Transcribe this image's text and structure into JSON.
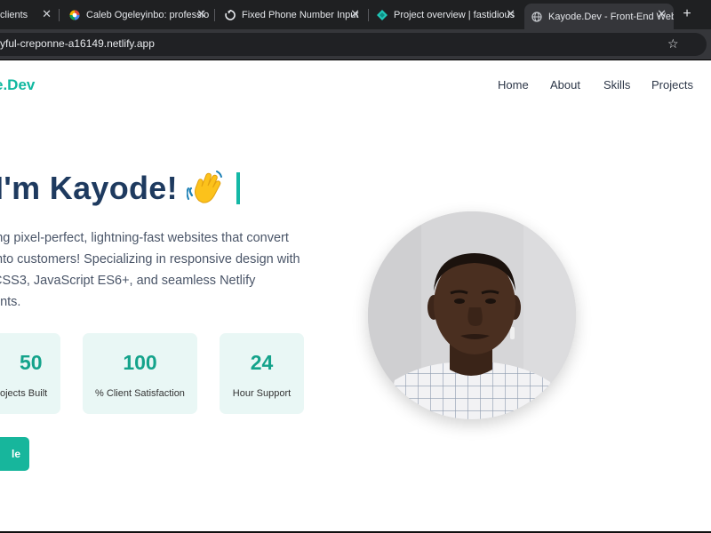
{
  "browser": {
    "tabs": [
      {
        "title": "clients",
        "favicon": "none",
        "active": false
      },
      {
        "title": "Caleb Ogeleyinbo: professio",
        "favicon": "colorful-circle-icon",
        "active": false
      },
      {
        "title": "Fixed Phone Number Input",
        "favicon": "loading-icon",
        "active": false
      },
      {
        "title": "Project overview | fastidious",
        "favicon": "netlify-diamond-icon",
        "active": false
      },
      {
        "title": "Kayode.Dev - Front-End Web",
        "favicon": "globe-icon",
        "active": true
      }
    ],
    "close_glyph": "✕",
    "new_tab_glyph": "+",
    "url": "yful-creponne-a16149.netlify.app",
    "star_glyph": "☆"
  },
  "site": {
    "logo": "e.Dev",
    "nav": [
      "Home",
      "About",
      "Skills",
      "Projects"
    ],
    "hero_title": "I'm Kayode!",
    "hero_desc_lines": [
      "ing pixel-perfect, lightning-fast websites that convert",
      "nto customers! Specializing in responsive design with",
      "CSS3, JavaScript ES6+, and seamless Netlify",
      "ents."
    ],
    "stats": [
      {
        "value": "50",
        "label": "ojects Built"
      },
      {
        "value": "100",
        "label": "% Client Satisfaction"
      },
      {
        "value": "24",
        "label": "Hour Support"
      }
    ],
    "cta_label": "le",
    "colors": {
      "accent": "#14b8a6",
      "heading": "#1e3a5f",
      "stat_bg": "#e9f7f5"
    }
  }
}
